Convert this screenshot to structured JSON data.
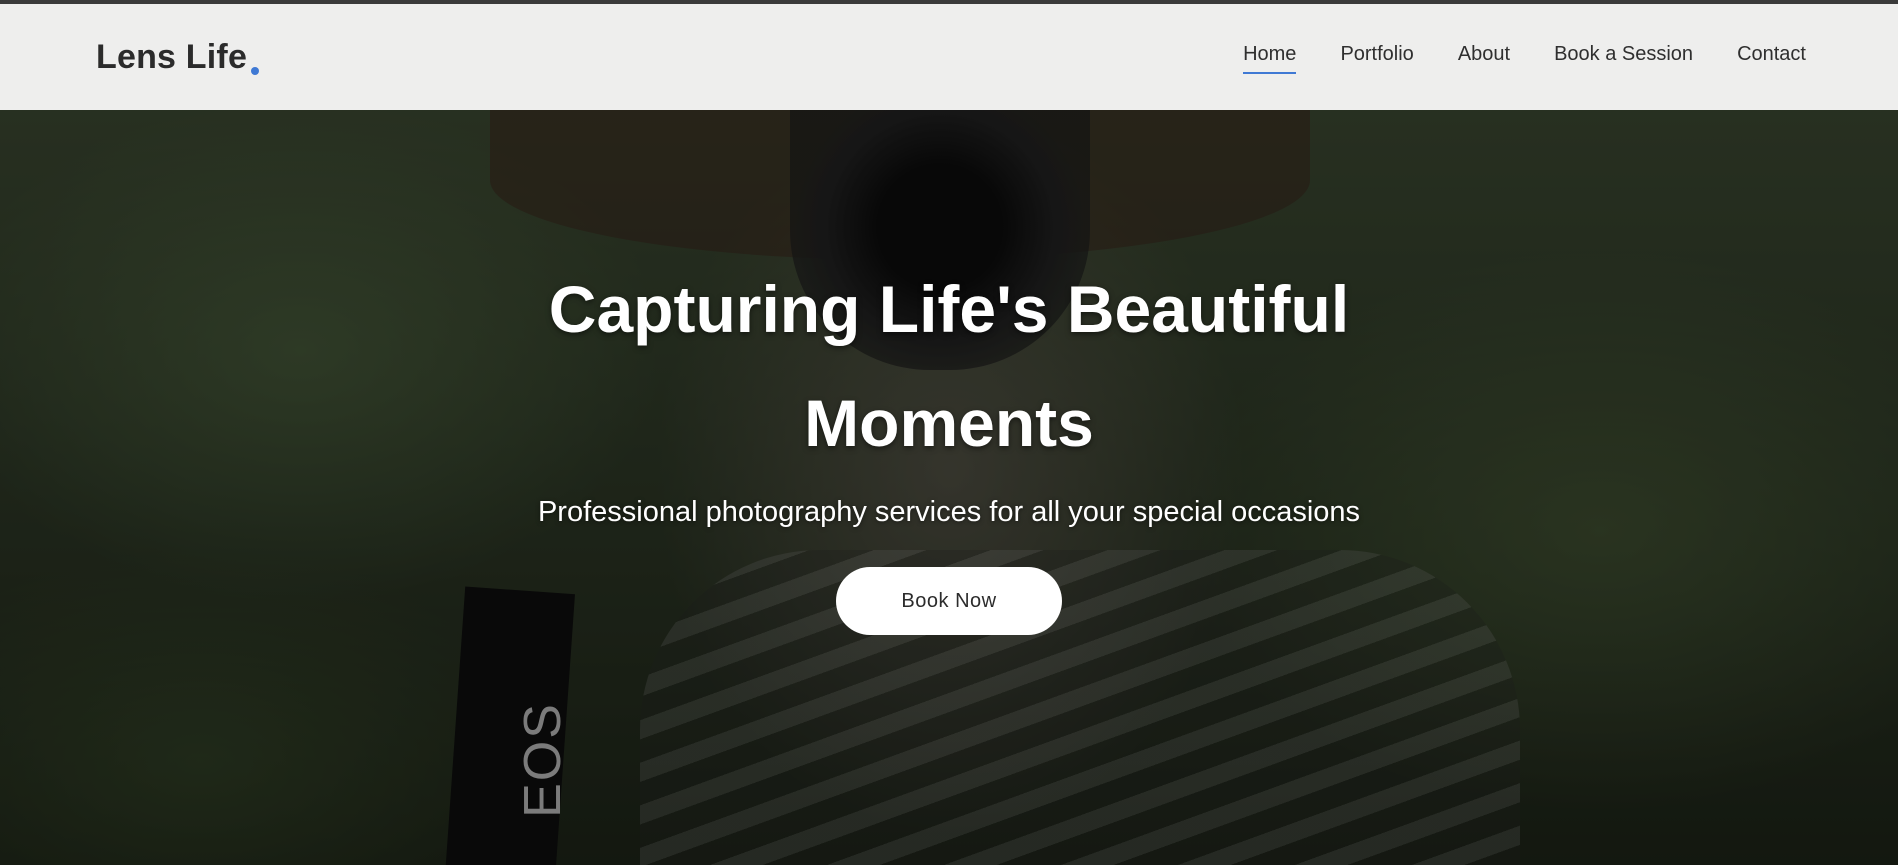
{
  "brand": {
    "name": "Lens Life",
    "accent_color": "#3f79d4"
  },
  "nav": {
    "items": [
      {
        "label": "Home",
        "active": true
      },
      {
        "label": "Portfolio",
        "active": false
      },
      {
        "label": "About",
        "active": false
      },
      {
        "label": "Book a Session",
        "active": false
      },
      {
        "label": "Contact",
        "active": false
      }
    ]
  },
  "hero": {
    "title": "Capturing Life's Beautiful Moments",
    "subtitle": "Professional photography services for all your special occasions",
    "cta_label": "Book Now",
    "background_image": "photographer holding Canon camera",
    "strap_text": "EOS"
  }
}
